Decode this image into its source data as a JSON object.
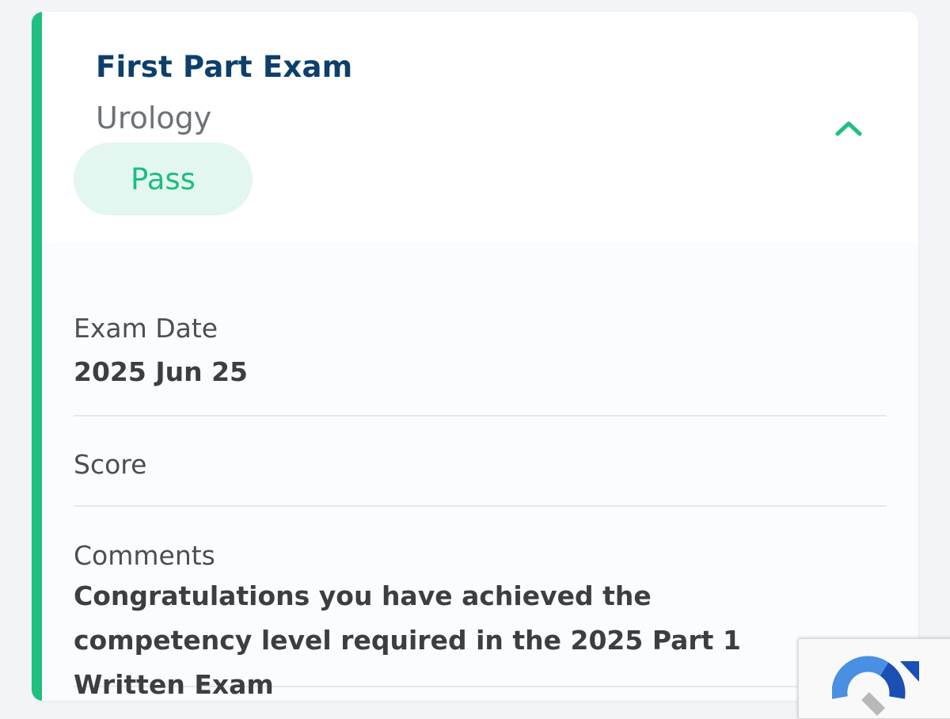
{
  "exam": {
    "title": "First Part Exam",
    "specialty": "Urology",
    "status": "Pass"
  },
  "details": {
    "exam_date_label": "Exam Date",
    "exam_date_value": "2025 Jun 25",
    "score_label": "Score",
    "score_value": "",
    "comments_label": "Comments",
    "comments_value": "Congratulations you have achieved the competency level required in the 2025 Part 1 Written Exam"
  },
  "colors": {
    "accent": "#1fbf7f",
    "title": "#0d3f6a",
    "status_text": "#1dbd82",
    "status_bg": "#e3f6ef"
  },
  "icons": {
    "collapse": "chevron-up-icon",
    "recaptcha": "recaptcha-logo-icon"
  }
}
